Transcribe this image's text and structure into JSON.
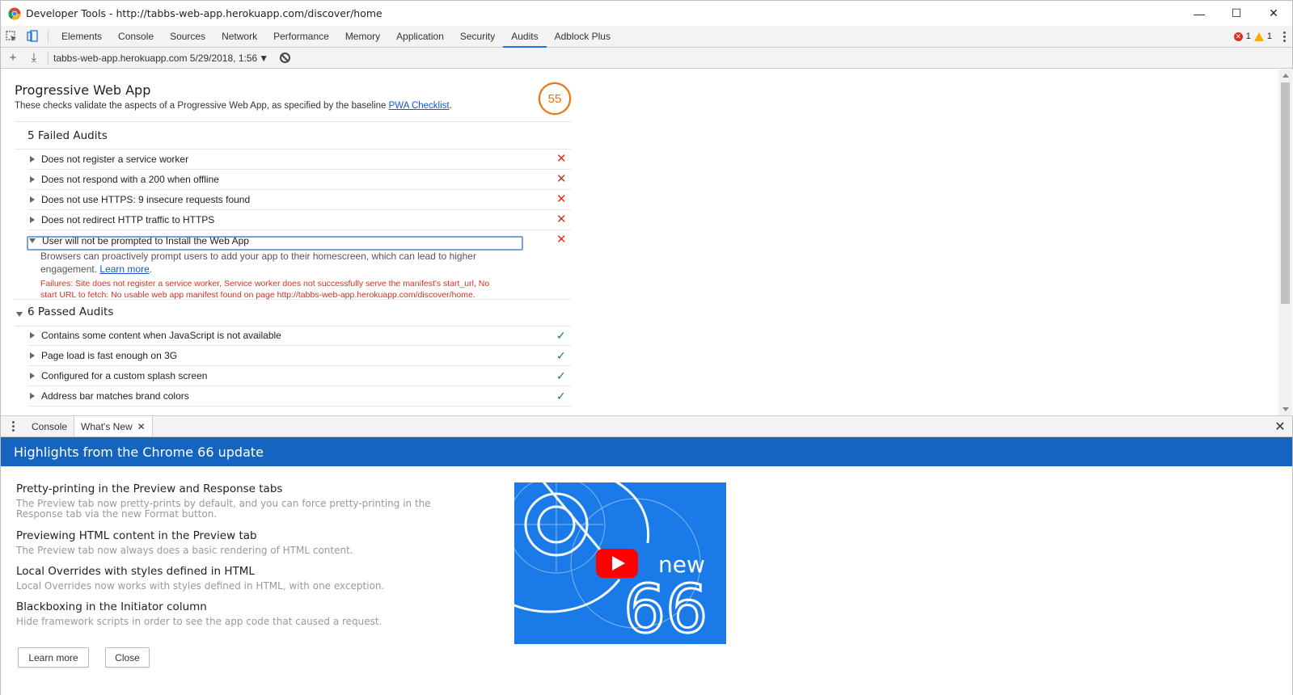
{
  "window": {
    "title": "Developer Tools - http://tabbs-web-app.herokuapp.com/discover/home",
    "controls": {
      "minimize": "—",
      "maximize": "☐",
      "close": "✕"
    }
  },
  "tabbar": {
    "tabs": [
      "Elements",
      "Console",
      "Sources",
      "Network",
      "Performance",
      "Memory",
      "Application",
      "Security",
      "Audits",
      "Adblock Plus"
    ],
    "active": "Audits",
    "error_count": "1",
    "warning_count": "1"
  },
  "subtoolbar": {
    "report_select": "tabbs-web-app.herokuapp.com 5/29/2018, 1:56",
    "add_icon": "+",
    "download_icon": "⤓"
  },
  "audits": {
    "section_title": "Progressive Web App",
    "section_desc": "These checks validate the aspects of a Progressive Web App, as specified by the baseline ",
    "section_link": "PWA Checklist",
    "section_desc_end": ".",
    "score": "55",
    "score_color": "#e8710a",
    "failed_title": "5 Failed Audits",
    "failed": [
      "Does not register a service worker",
      "Does not respond with a 200 when offline",
      "Does not use HTTPS: 9 insecure requests found",
      "Does not redirect HTTP traffic to HTTPS",
      "User will not be prompted to Install the Web App"
    ],
    "expanded_desc_1": "Browsers can proactively prompt users to add your app to their homescreen, which can lead to higher",
    "expanded_desc_2": "engagement. ",
    "expanded_link": "Learn more",
    "expanded_desc_end": ".",
    "failures_line1": "Failures: Site does not register a service worker, Service worker does not successfully serve the manifest's start_url, No",
    "failures_line2": "start URL to fetch: No usable web app manifest found on page http://tabbs-web-app.herokuapp.com/discover/home.",
    "passed_title": "6 Passed Audits",
    "passed": [
      "Contains some content when JavaScript is not available",
      "Page load is fast enough on 3G",
      "Configured for a custom splash screen",
      "Address bar matches brand colors"
    ]
  },
  "drawer": {
    "tabs": [
      "Console",
      "What's New"
    ],
    "active": "What's New",
    "banner": "Highlights from the Chrome 66 update",
    "items": [
      {
        "head": "Pretty-printing in the Preview and Response tabs",
        "body": "The Preview tab now pretty-prints by default, and you can force pretty-printing in the Response tab via the new Format button."
      },
      {
        "head": "Previewing HTML content in the Preview tab",
        "body": "The Preview tab now always does a basic rendering of HTML content."
      },
      {
        "head": "Local Overrides with styles defined in HTML",
        "body": "Local Overrides now works with styles defined in HTML, with one exception."
      },
      {
        "head": "Blackboxing in the Initiator column",
        "body": "Hide framework scripts in order to see the app code that caused a request."
      }
    ],
    "learn_more": "Learn more",
    "close": "Close",
    "video": {
      "label_new": "new",
      "label_num": "66",
      "bg": "#1a7be8",
      "play_color": "#ff0000"
    }
  }
}
